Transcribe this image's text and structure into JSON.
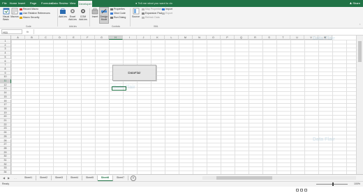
{
  "tabs": [
    "File",
    "Home",
    "Insert",
    "Page Layout",
    "Formulas",
    "Data",
    "Review",
    "View",
    "Developer"
  ],
  "active_tab": "Developer",
  "tell_me": "Tell me what you want to do",
  "share": "Share",
  "ribbon": {
    "visual_basic": "Visual Basic",
    "macros": "Macros",
    "record_macro": "Record Macro",
    "relative_refs": "Use Relative References",
    "macro_security": "Macro Security",
    "group_code": "Code",
    "addins": "Add-ins",
    "excel_addins": "Excel Add-ins",
    "com_addins": "COM Add-ins",
    "group_addins": "Add-ins",
    "insert": "Insert",
    "design_mode": "Design Mode",
    "properties": "Properties",
    "view_code": "View Code",
    "run_dialog": "Run Dialog",
    "group_controls": "Controls",
    "source": "Source",
    "map_properties": "Map Properties",
    "expansion_packs": "Expansion Packs",
    "refresh_data": "Refresh Data",
    "import": "Import",
    "export": "Export",
    "group_xml": "XML"
  },
  "formula_bar": {
    "name_box": "H11",
    "fx": "fx",
    "value": ""
  },
  "columns": [
    "A",
    "B",
    "C",
    "D",
    "E",
    "F",
    "G",
    "H",
    "I",
    "J",
    "K",
    "L",
    "M",
    "N",
    "O",
    "P",
    "Q",
    "R",
    "S",
    "T",
    "U",
    "V",
    "W"
  ],
  "selected_column": "H",
  "rows": [
    "1",
    "2",
    "3",
    "4",
    "5",
    "6",
    "7",
    "8",
    "9",
    "10",
    "11",
    "12",
    "13",
    "14",
    "15",
    "16",
    "17",
    "18",
    "19",
    "20",
    "21",
    "22",
    "23",
    "24",
    "25",
    "26",
    "27",
    "28",
    "29",
    "30",
    "31",
    "32",
    "33",
    "34"
  ],
  "selected_row": "11",
  "button_label": "DataFlair",
  "watermark": "Data Flair",
  "sheets": [
    "Sheet1",
    "Sheet2",
    "Sheet3",
    "Sheet4",
    "Sheet5",
    "Sheet6",
    "Sheet7"
  ],
  "active_sheet": "Sheet6",
  "status": {
    "text": "Ready",
    "zoom": "100%"
  },
  "colors": {
    "accent": "#217346",
    "ribbon_bg": "#f3f3f3"
  }
}
